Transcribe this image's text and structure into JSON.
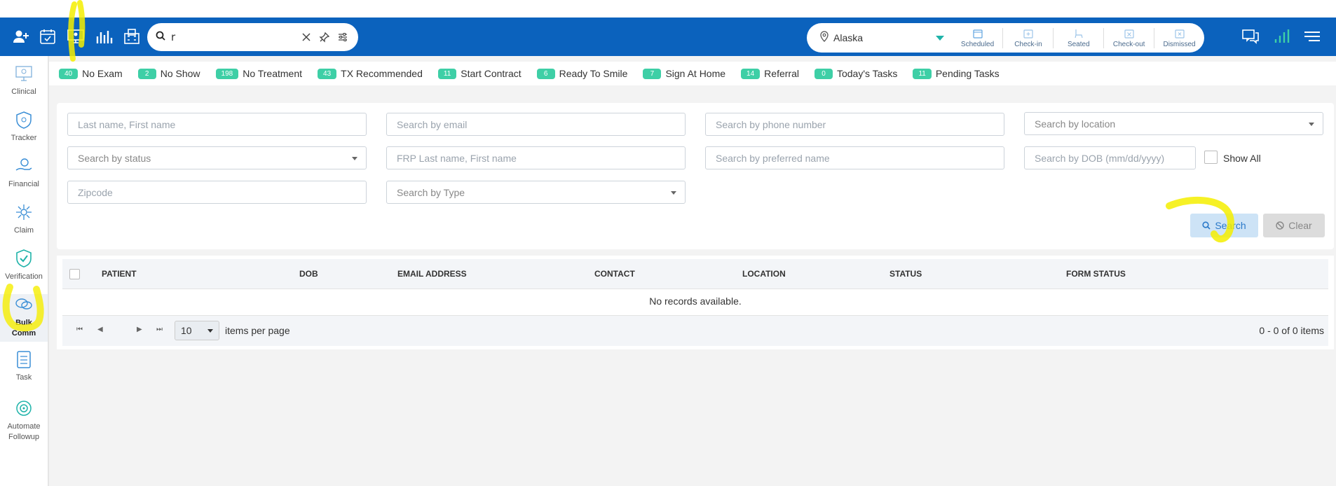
{
  "topbar": {
    "icons": [
      "add-user-icon",
      "calendar-check-icon",
      "monitor-icon",
      "bar-chart-icon",
      "building-icon"
    ],
    "search": {
      "value": "r"
    },
    "location": {
      "name": "Alaska"
    },
    "statuses": [
      {
        "label": "Scheduled",
        "icon": "calendar-icon"
      },
      {
        "label": "Check-in",
        "icon": "checkin-icon"
      },
      {
        "label": "Seated",
        "icon": "chair-icon"
      },
      {
        "label": "Check-out",
        "icon": "checkout-icon"
      },
      {
        "label": "Dismissed",
        "icon": "dismissed-icon"
      }
    ],
    "right_icons": [
      "chat-icon",
      "signal-icon",
      "menu-icon"
    ]
  },
  "sidebar": {
    "items": [
      {
        "label": "Clinical",
        "icon": "clinical-icon"
      },
      {
        "label": "Tracker",
        "icon": "tracker-icon"
      },
      {
        "label": "Financial",
        "icon": "financial-icon"
      },
      {
        "label": "Claim",
        "icon": "claim-icon"
      },
      {
        "label": "Verification",
        "icon": "verification-icon"
      },
      {
        "label": "Bulk Comm",
        "icon": "bulk-comm-icon",
        "active": true
      },
      {
        "label": "Task",
        "icon": "task-icon"
      },
      {
        "label": "Automate Followup",
        "icon": "automate-icon"
      }
    ]
  },
  "chips": [
    {
      "count": "40",
      "label": "No Exam"
    },
    {
      "count": "2",
      "label": "No Show"
    },
    {
      "count": "198",
      "label": "No Treatment"
    },
    {
      "count": "43",
      "label": "TX Recommended"
    },
    {
      "count": "11",
      "label": "Start Contract"
    },
    {
      "count": "6",
      "label": "Ready To Smile"
    },
    {
      "count": "7",
      "label": "Sign At Home"
    },
    {
      "count": "14",
      "label": "Referral"
    },
    {
      "count": "0",
      "label": "Today's Tasks"
    },
    {
      "count": "11",
      "label": "Pending Tasks"
    }
  ],
  "filters": {
    "name": "Last name, First name",
    "email": "Search by email",
    "phone": "Search by phone number",
    "location": "Search by location",
    "status": "Search by status",
    "frp": "FRP Last name, First name",
    "preferred": "Search by preferred name",
    "dob": "Search by DOB (mm/dd/yyyy)",
    "show_all": "Show All",
    "zipcode": "Zipcode",
    "type": "Search by Type",
    "search_btn": "Search",
    "clear_btn": "Clear"
  },
  "grid": {
    "columns": [
      "PATIENT",
      "DOB",
      "EMAIL ADDRESS",
      "CONTACT",
      "LOCATION",
      "STATUS",
      "FORM STATUS"
    ],
    "empty": "No records available.",
    "page_size": "10",
    "items_per_page": "items per page",
    "page_info": "0 - 0 of 0 items"
  },
  "colors": {
    "topbar": "#0b62bd",
    "chip": "#3ecfa6",
    "highlight": "#ffff00"
  }
}
